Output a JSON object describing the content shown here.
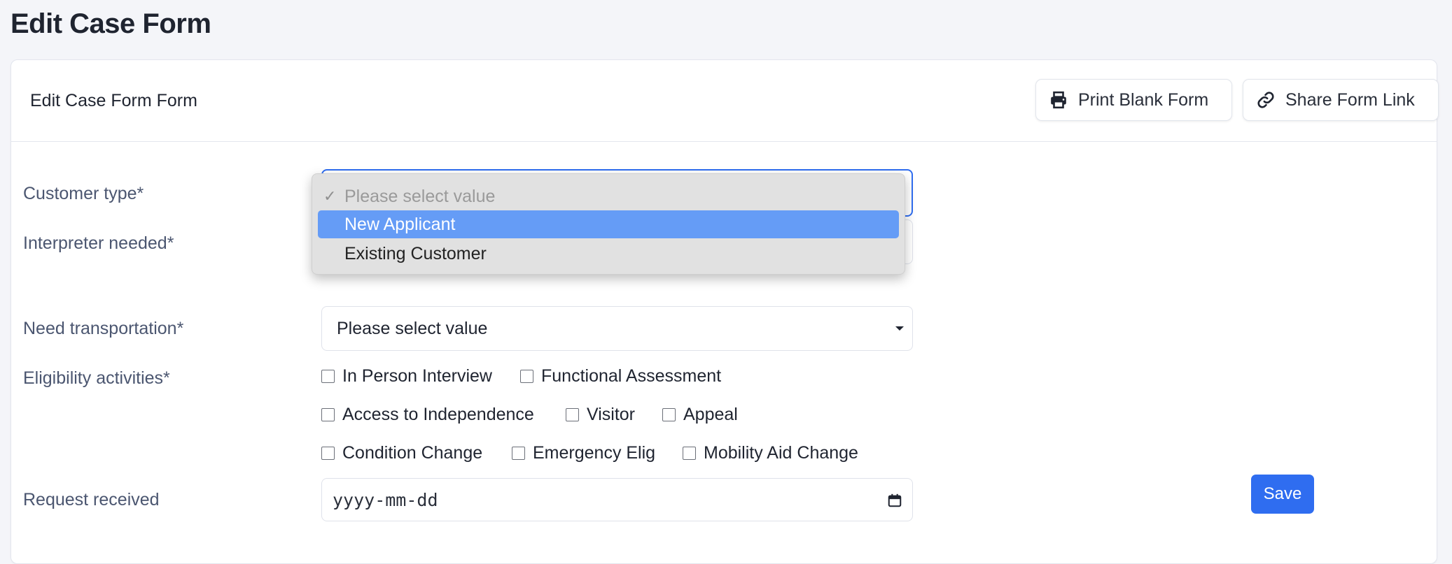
{
  "page_title": "Edit Case Form",
  "card": {
    "title": "Edit Case Form Form",
    "print_button": "Print Blank Form",
    "share_button": "Share Form Link"
  },
  "fields": {
    "customer_type": {
      "label": "Customer type*",
      "options": [
        "Please select value",
        "New Applicant",
        "Existing Customer"
      ],
      "highlighted": "New Applicant"
    },
    "interpreter_needed": {
      "label": "Interpreter needed*"
    },
    "need_transportation": {
      "label": "Need transportation*",
      "value": "Please select value"
    },
    "eligibility_activities": {
      "label": "Eligibility activities*",
      "options": [
        "In Person Interview",
        "Functional Assessment",
        "Access to Independence",
        "Visitor",
        "Appeal",
        "Condition Change",
        "Emergency Elig",
        "Mobility Aid Change"
      ]
    },
    "request_received": {
      "label": "Request received",
      "placeholder": "yyyy-mm-dd"
    }
  },
  "save_button": "Save",
  "colors": {
    "accent": "#2f6df0",
    "highlight": "#659cf6",
    "page_background": "#f4f5f9"
  },
  "icons": {
    "print": "printer-icon",
    "share": "link-icon",
    "date": "calendar-icon"
  }
}
